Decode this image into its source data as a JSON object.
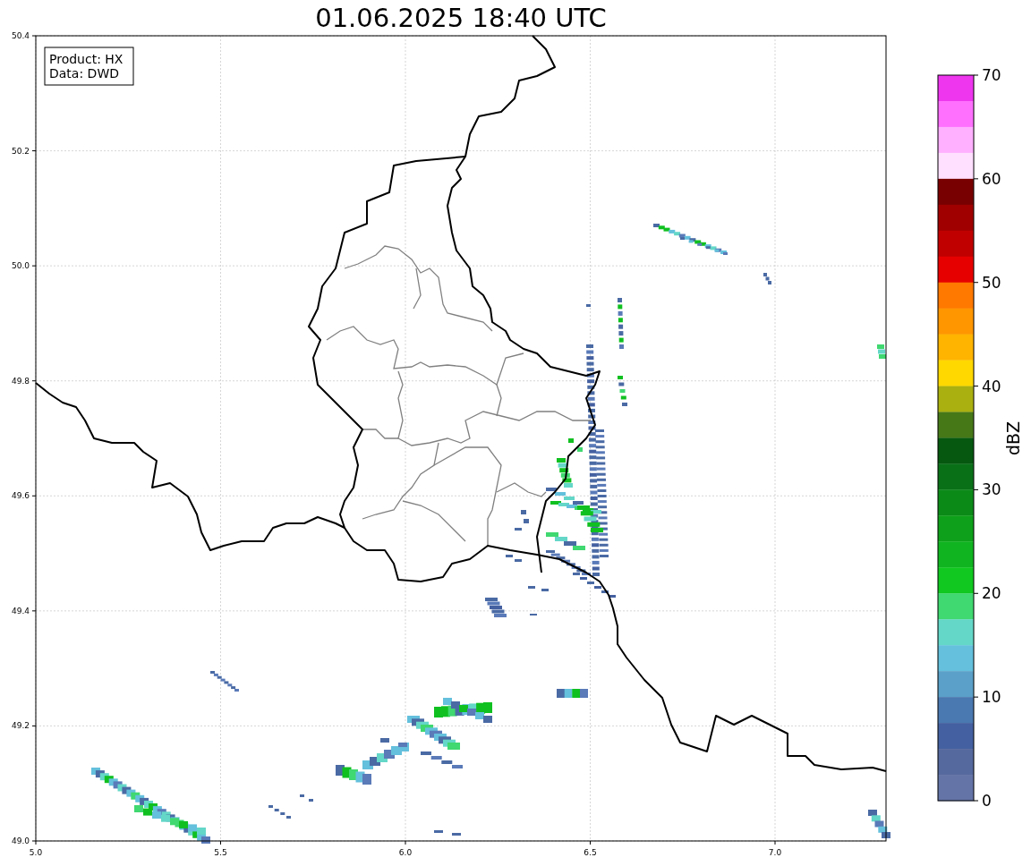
{
  "title": "01.06.2025 18:40 UTC",
  "map": {
    "xticks": [
      "5.0",
      "5.5",
      "6.0",
      "6.5",
      "7.0"
    ],
    "yticks": [
      "50.4",
      "50.2",
      "50.0",
      "49.8",
      "49.6",
      "49.4",
      "49.2",
      "49.0"
    ],
    "annotation": [
      "Product: HX",
      "Data: DWD"
    ]
  },
  "colorbar": {
    "label": "dBZ",
    "ticks": [
      "70",
      "60",
      "50",
      "40",
      "30",
      "20",
      "10",
      "0"
    ],
    "segments": [
      {
        "color": "#ee36ee"
      },
      {
        "color": "#ff70ff"
      },
      {
        "color": "#ffb0ff"
      },
      {
        "color": "#ffe0ff"
      },
      {
        "color": "#780000"
      },
      {
        "color": "#a00000"
      },
      {
        "color": "#c00000"
      },
      {
        "color": "#e60000"
      },
      {
        "color": "#ff7800"
      },
      {
        "color": "#ff9600"
      },
      {
        "color": "#ffb400"
      },
      {
        "color": "#ffd800"
      },
      {
        "color": "#aab010"
      },
      {
        "color": "#467818"
      },
      {
        "color": "#065810"
      },
      {
        "color": "#0a7018"
      },
      {
        "color": "#0c8a18"
      },
      {
        "color": "#0ea01a"
      },
      {
        "color": "#10b420"
      },
      {
        "color": "#10c820"
      },
      {
        "color": "#40d870"
      },
      {
        "color": "#64d7c8"
      },
      {
        "color": "#64c0dc"
      },
      {
        "color": "#5aa0c8"
      },
      {
        "color": "#4a78b0"
      },
      {
        "color": "#4460a0"
      },
      {
        "color": "#56699e"
      },
      {
        "color": "#6474a6"
      }
    ]
  }
}
